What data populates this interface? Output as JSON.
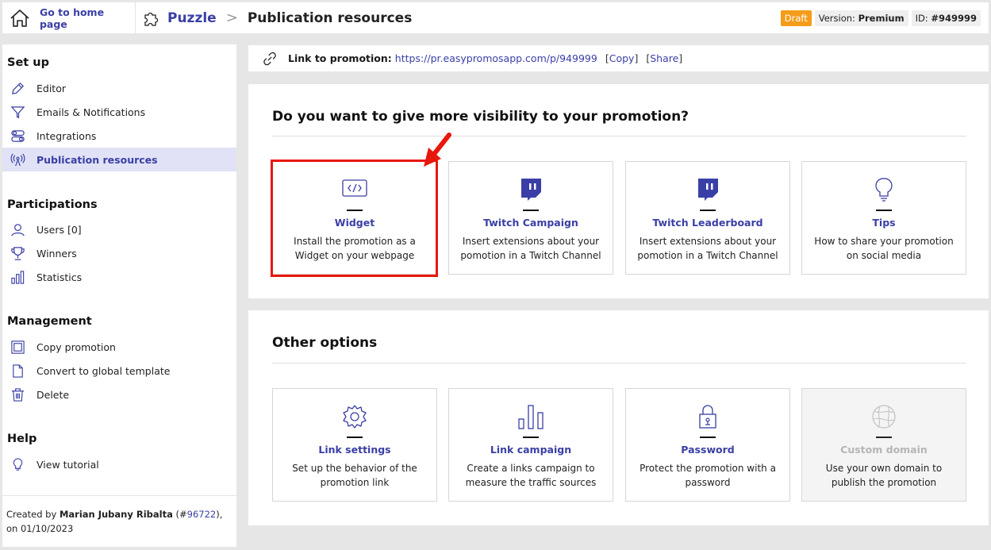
{
  "topbar": {
    "home_link": "Go to home page",
    "app_name": "Puzzle",
    "separator": ">",
    "page_title": "Publication resources",
    "status_badge": "Draft",
    "version_label": "Version:",
    "version_value": "Premium",
    "id_label": "ID:",
    "id_value": "#949999"
  },
  "sidebar": {
    "sections": [
      {
        "title": "Set up",
        "items": [
          {
            "label": "Editor",
            "icon": "pencil-icon"
          },
          {
            "label": "Emails & Notifications",
            "icon": "filter-icon"
          },
          {
            "label": "Integrations",
            "icon": "toggles-icon"
          },
          {
            "label": "Publication resources",
            "icon": "broadcast-icon",
            "active": true
          }
        ]
      },
      {
        "title": "Participations",
        "items": [
          {
            "label": "Users [0]",
            "icon": "user-icon"
          },
          {
            "label": "Winners",
            "icon": "trophy-icon"
          },
          {
            "label": "Statistics",
            "icon": "bar-chart-icon"
          }
        ]
      },
      {
        "title": "Management",
        "items": [
          {
            "label": "Copy promotion",
            "icon": "copy-icon"
          },
          {
            "label": "Convert to global template",
            "icon": "file-icon"
          },
          {
            "label": "Delete",
            "icon": "trash-icon"
          }
        ]
      },
      {
        "title": "Help",
        "items": [
          {
            "label": "View tutorial",
            "icon": "lightbulb-icon"
          }
        ]
      }
    ],
    "footer": {
      "prefix": "Created by",
      "author": "Marian Jubany Ribalta",
      "open": "(#",
      "author_id": "96722",
      "close": "), on",
      "date": "01/10/2023"
    }
  },
  "linkbar": {
    "label": "Link to promotion:",
    "url": "https://pr.easypromosapp.com/p/949999",
    "copy": "Copy",
    "share": "Share"
  },
  "visibility": {
    "title": "Do you want to give more visibility to your promotion?",
    "cards": [
      {
        "title": "Widget",
        "desc": "Install the promotion as a Widget on your webpage",
        "icon": "code-icon",
        "highlighted": true
      },
      {
        "title": "Twitch Campaign",
        "desc": "Insert extensions about your pomotion in a Twitch Channel",
        "icon": "twitch-icon"
      },
      {
        "title": "Twitch Leaderboard",
        "desc": "Insert extensions about your pomotion in a Twitch Channel",
        "icon": "twitch-icon"
      },
      {
        "title": "Tips",
        "desc": "How to share your promotion on social media",
        "icon": "lightbulb-icon"
      }
    ]
  },
  "other": {
    "title": "Other options",
    "cards": [
      {
        "title": "Link settings",
        "desc": "Set up the behavior of the promotion link",
        "icon": "gear-icon"
      },
      {
        "title": "Link campaign",
        "desc": "Create a links campaign to measure the traffic sources",
        "icon": "bar-chart-icon"
      },
      {
        "title": "Password",
        "desc": "Protect the promotion with a password",
        "icon": "lock-icon"
      },
      {
        "title": "Custom domain",
        "desc": "Use your own domain to publish the promotion",
        "icon": "globe-icon",
        "disabled": true
      }
    ]
  },
  "colors": {
    "accent": "#3a3fa5",
    "draft": "#f59c1a",
    "highlight": "#e8170c",
    "active_bg": "#e1e2f6"
  }
}
